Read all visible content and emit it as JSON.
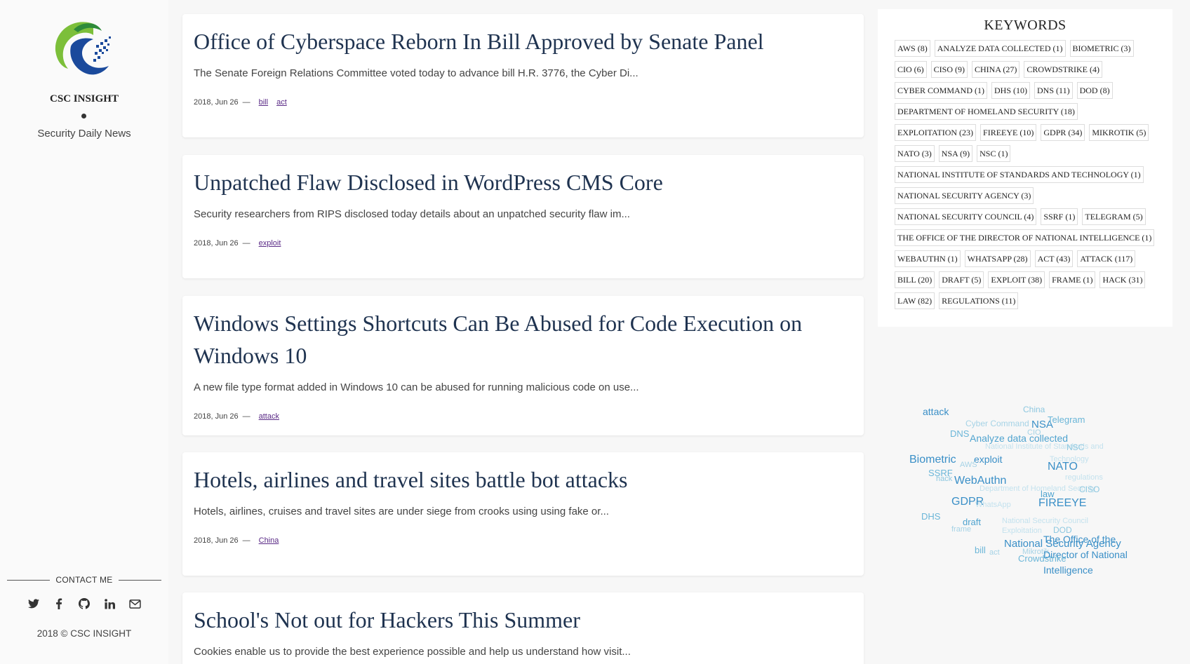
{
  "sidebar": {
    "site_name": "CSC INSIGHT",
    "tagline": "Security Daily News",
    "contact_label": "CONTACT ME",
    "socials": [
      "twitter-icon",
      "facebook-icon",
      "github-icon",
      "linkedin-icon",
      "envelope-icon"
    ],
    "copyright": "2018 © CSC INSIGHT"
  },
  "posts": [
    {
      "title": "Office of Cyberspace Reborn In Bill Approved by Senate Panel",
      "excerpt": "The Senate Foreign Relations Committee voted today to advance bill H.R. 3776, the Cyber Di...",
      "date": "2018, Jun 26",
      "sep": "—",
      "tags": [
        "bill",
        "act"
      ]
    },
    {
      "title": "Unpatched Flaw Disclosed in WordPress CMS Core",
      "excerpt": "Security researchers from RIPS disclosed today details about an unpatched security flaw im...",
      "date": "2018, Jun 26",
      "sep": "—",
      "tags": [
        "exploit"
      ]
    },
    {
      "title": "Windows Settings Shortcuts Can Be Abused for Code Execution on Windows 10",
      "excerpt": "A new file type format added in Windows 10 can be abused for running malicious code on use...",
      "date": "2018, Jun 26",
      "sep": "—",
      "tags": [
        "attack"
      ]
    },
    {
      "title": "Hotels, airlines and travel sites battle bot attacks",
      "excerpt": "Hotels, airlines, cruises and travel sites are under siege from crooks using using fake or...",
      "date": "2018, Jun 26",
      "sep": "—",
      "tags": [
        "China"
      ]
    },
    {
      "title": "School's Not out for Hackers This Summer",
      "excerpt": "Cookies enable us to provide the best experience possible and help us understand how visit...",
      "date": "",
      "sep": "",
      "tags": []
    }
  ],
  "keywords": {
    "title": "KEYWORDS",
    "items": [
      "AWS (8)",
      "ANALYZE DATA COLLECTED (1)",
      "BIOMETRIC (3)",
      "CIO (6)",
      "CISO (9)",
      "CHINA (27)",
      "CROWDSTRIKE (4)",
      "CYBER COMMAND (1)",
      "DHS (10)",
      "DNS (11)",
      "DOD (8)",
      "DEPARTMENT OF HOMELAND SECURITY (18)",
      "EXPLOITATION (23)",
      "FIREEYE (10)",
      "GDPR (34)",
      "MIKROTIK (5)",
      "NATO (3)",
      "NSA (9)",
      "NSC (1)",
      "NATIONAL INSTITUTE OF STANDARDS AND TECHNOLOGY (1)",
      "NATIONAL SECURITY AGENCY (3)",
      "NATIONAL SECURITY COUNCIL (4)",
      "SSRF (1)",
      "TELEGRAM (5)",
      "THE OFFICE OF THE DIRECTOR OF NATIONAL INTELLIGENCE (1)",
      "WEBAUTHN (1)",
      "WHATSAPP (28)",
      "ACT (43)",
      "ATTACK (117)",
      "BILL (20)",
      "DRAFT (5)",
      "EXPLOIT (38)",
      "FRAME (1)",
      "HACK (31)",
      "LAW (82)",
      "REGULATIONS (11)"
    ]
  },
  "cloud": {
    "words": [
      {
        "text": "attack",
        "size": 14,
        "color": "#3a8fc7",
        "weight": 1
      },
      {
        "text": "China",
        "size": 12,
        "color": "#8ec8e0",
        "weight": 0.6
      },
      {
        "text": "Cyber Command",
        "size": 12,
        "color": "#a6d3e6",
        "weight": 0.5
      },
      {
        "text": "NSA",
        "size": 15,
        "color": "#3a8fc7",
        "weight": 1
      },
      {
        "text": "Telegram",
        "size": 13,
        "color": "#6bb6d8",
        "weight": 0.8
      },
      {
        "text": "DNS",
        "size": 13,
        "color": "#6bb6d8",
        "weight": 0.8
      },
      {
        "text": "CIO",
        "size": 11,
        "color": "#a6d3e6",
        "weight": 0.5
      },
      {
        "text": "Analyze data collected",
        "size": 14,
        "color": "#4fa3cf",
        "weight": 0.9
      },
      {
        "text": "National Institute of Standards and",
        "size": 11,
        "color": "#c4e2ee",
        "weight": 0.4
      },
      {
        "text": "NSC",
        "size": 12,
        "color": "#8ec8e0",
        "weight": 0.6
      },
      {
        "text": "Technology",
        "size": 11,
        "color": "#c4e2ee",
        "weight": 0.4
      },
      {
        "text": "Biometric",
        "size": 16,
        "color": "#3a8fc7",
        "weight": 1
      },
      {
        "text": "exploit",
        "size": 14,
        "color": "#3a8fc7",
        "weight": 1
      },
      {
        "text": "AWS",
        "size": 11,
        "color": "#a6d3e6",
        "weight": 0.5
      },
      {
        "text": "NATO",
        "size": 16,
        "color": "#3a8fc7",
        "weight": 1
      },
      {
        "text": "SSRF",
        "size": 13,
        "color": "#6bb6d8",
        "weight": 0.8
      },
      {
        "text": "hack",
        "size": 11,
        "color": "#8ec8e0",
        "weight": 0.6
      },
      {
        "text": "WebAuthn",
        "size": 16,
        "color": "#3a8fc7",
        "weight": 1
      },
      {
        "text": "regulations",
        "size": 11,
        "color": "#c4e2ee",
        "weight": 0.4
      },
      {
        "text": "Department of Homeland Security",
        "size": 11,
        "color": "#c4e2ee",
        "weight": 0.4
      },
      {
        "text": "CISO",
        "size": 12,
        "color": "#8ec8e0",
        "weight": 0.6
      },
      {
        "text": "law",
        "size": 13,
        "color": "#4fa3cf",
        "weight": 0.9
      },
      {
        "text": "GDPR",
        "size": 16,
        "color": "#3a8fc7",
        "weight": 1
      },
      {
        "text": "WhatsApp",
        "size": 11,
        "color": "#c4e2ee",
        "weight": 0.4
      },
      {
        "text": "FIREEYE",
        "size": 16,
        "color": "#3a8fc7",
        "weight": 1
      },
      {
        "text": "DHS",
        "size": 13,
        "color": "#6bb6d8",
        "weight": 0.8
      },
      {
        "text": "National Security Council",
        "size": 11,
        "color": "#c4e2ee",
        "weight": 0.4
      },
      {
        "text": "draft",
        "size": 13,
        "color": "#4fa3cf",
        "weight": 0.9
      },
      {
        "text": "frame",
        "size": 11,
        "color": "#a6d3e6",
        "weight": 0.5
      },
      {
        "text": "Exploitation",
        "size": 11,
        "color": "#c4e2ee",
        "weight": 0.4
      },
      {
        "text": "DOD",
        "size": 12,
        "color": "#8ec8e0",
        "weight": 0.6
      },
      {
        "text": "The Office of the",
        "size": 14,
        "color": "#3a8fc7",
        "weight": 1
      },
      {
        "text": "National Security Agency",
        "size": 15,
        "color": "#3a8fc7",
        "weight": 1
      },
      {
        "text": "bill",
        "size": 13,
        "color": "#6bb6d8",
        "weight": 0.8
      },
      {
        "text": "act",
        "size": 11,
        "color": "#a6d3e6",
        "weight": 0.5
      },
      {
        "text": "Mikrotik",
        "size": 11,
        "color": "#a6d3e6",
        "weight": 0.5
      },
      {
        "text": "Director of National",
        "size": 14,
        "color": "#3a8fc7",
        "weight": 1
      },
      {
        "text": "Crowdstrike",
        "size": 13,
        "color": "#6bb6d8",
        "weight": 0.8
      },
      {
        "text": "Intelligence",
        "size": 14,
        "color": "#3a8fc7",
        "weight": 1
      }
    ]
  }
}
